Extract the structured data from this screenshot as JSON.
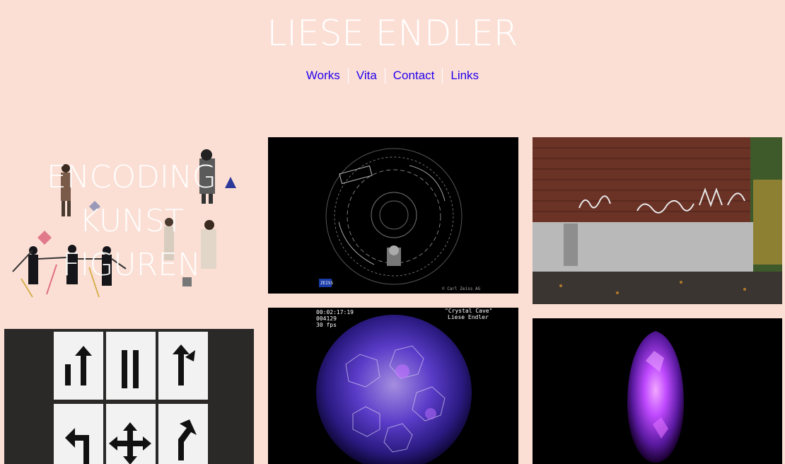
{
  "header": {
    "title": "LIESE ENDLER",
    "nav": [
      {
        "label": "Works"
      },
      {
        "label": "Vita"
      },
      {
        "label": "Contact"
      },
      {
        "label": "Links"
      }
    ]
  },
  "works": {
    "encoding": {
      "lines": [
        "ENCODING",
        "KUNST",
        "FIGUREN"
      ]
    },
    "dome": {
      "brand": "ZEISS",
      "copyright": "© Carl Zeiss AG"
    },
    "crystal": {
      "timecode": "00:02:17:19",
      "frame": "004129",
      "fps": "30 fps",
      "caption": "\"Crystal Cave\"",
      "artist": "Liese Endler"
    },
    "graffiti": {
      "tags": [
        "SOMR",
        "MAXS"
      ]
    }
  },
  "colors": {
    "background": "#fbdfd5",
    "link": "#2200ee",
    "title": "#ffffff",
    "accent_purple": "#8a2be2"
  }
}
